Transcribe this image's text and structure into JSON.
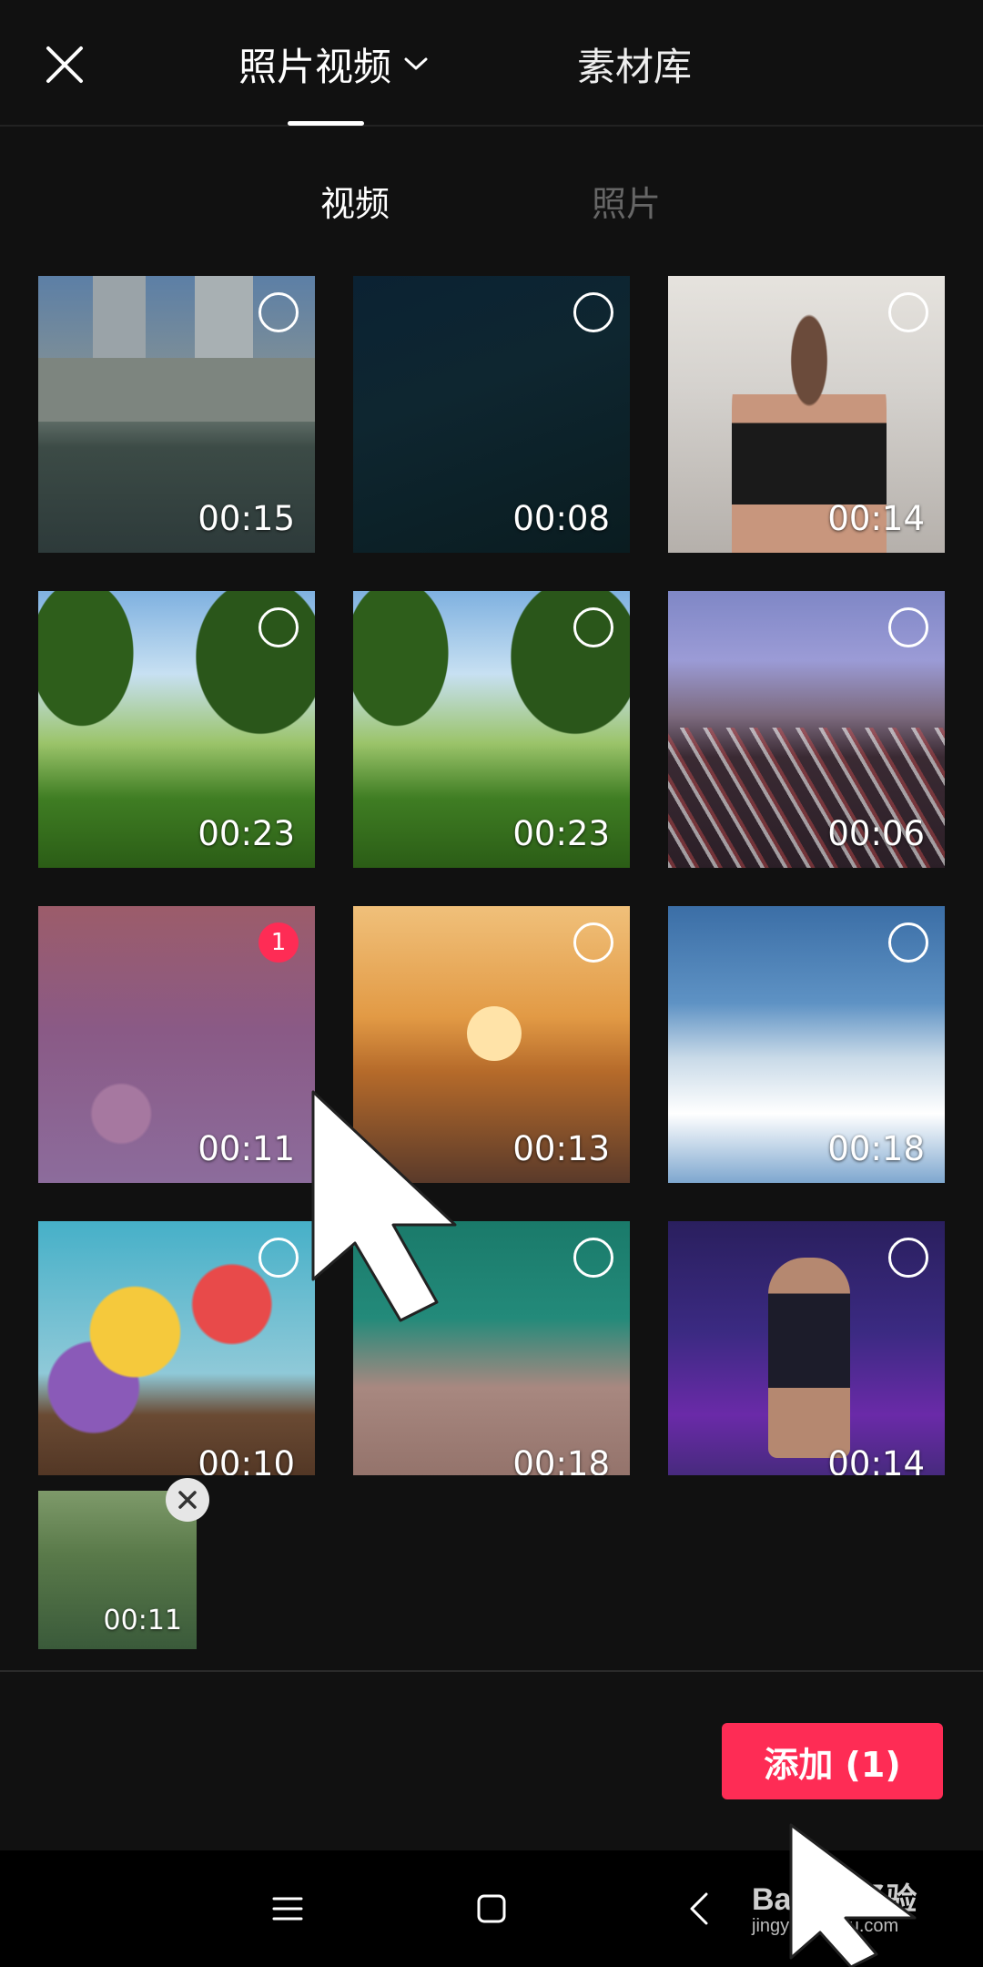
{
  "header": {
    "close_icon": "close-icon",
    "tab_photo_video": "照片视频",
    "tab_library": "素材库",
    "caret_icon": "chevron-down-icon"
  },
  "subtabs": {
    "video": "视频",
    "photo": "照片"
  },
  "media": [
    {
      "duration": "00:15",
      "selected": false
    },
    {
      "duration": "00:08",
      "selected": false
    },
    {
      "duration": "00:14",
      "selected": false
    },
    {
      "duration": "00:23",
      "selected": false
    },
    {
      "duration": "00:23",
      "selected": false
    },
    {
      "duration": "00:06",
      "selected": false
    },
    {
      "duration": "00:11",
      "selected": true,
      "order": "1"
    },
    {
      "duration": "00:13",
      "selected": false
    },
    {
      "duration": "00:18",
      "selected": false
    },
    {
      "duration": "00:10",
      "selected": false
    },
    {
      "duration": "00:18",
      "selected": false
    },
    {
      "duration": "00:14",
      "selected": false
    }
  ],
  "selected_tray": {
    "items": [
      {
        "duration": "00:11"
      }
    ]
  },
  "bottom": {
    "add_label": "添加 (1)",
    "accent": "#fe2c55"
  },
  "nav": {
    "menu_icon": "menu-icon",
    "home_icon": "square-icon",
    "back_icon": "back-chevron-icon"
  },
  "watermark": {
    "text": "Bai du 经验",
    "sub": "jingyan.baidu.com"
  }
}
